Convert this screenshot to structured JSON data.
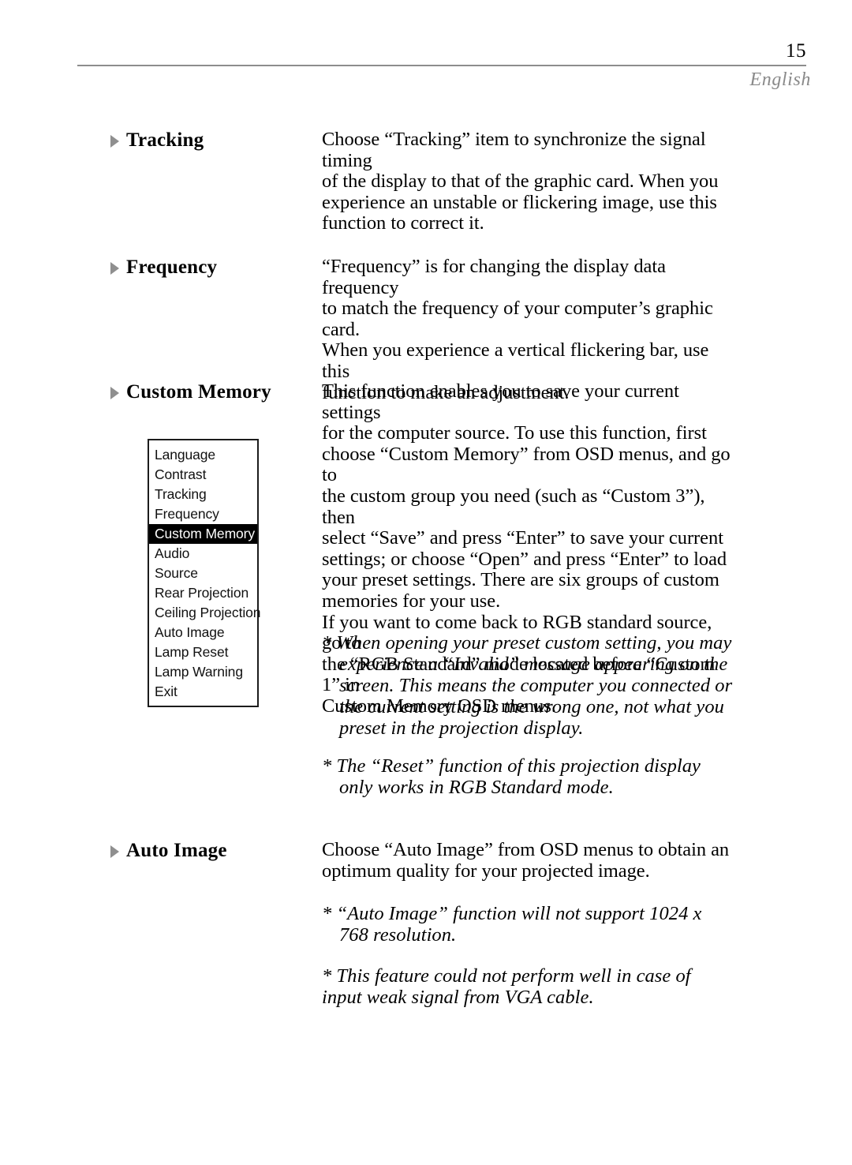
{
  "header": {
    "page_number": "15",
    "language_label": "English"
  },
  "sections": [
    {
      "id": "tracking",
      "heading": "Tracking",
      "bullet_icon": "triangle-right-icon",
      "body": "Choose “Tracking” item to synchronize the signal timing\nof the display to that of the graphic card.  When you\nexperience an unstable or flickering image, use this\nfunction to correct it."
    },
    {
      "id": "frequency",
      "heading": "Frequency",
      "bullet_icon": "triangle-right-icon",
      "body": "“Frequency” is for changing the display data frequency\nto match the frequency of your computer’s graphic card.\nWhen you experience a vertical flickering bar, use this\nfunction to make an adjustment."
    },
    {
      "id": "custom-memory",
      "heading": "Custom Memory",
      "bullet_icon": "triangle-right-icon",
      "body": "This function enables you to save your current settings\nfor the computer source.  To use this function, first\nchoose “Custom Memory” from OSD menus, and go to\nthe custom group you need (such as “Custom 3”), then\nselect “Save” and press “Enter” to save your current\nsettings; or choose “Open” and press “Enter” to load\nyour preset settings. There are six groups of custom\nmemories for your use.\nIf you want to come back to RGB standard source, go to\nthe “RGB Standard” mode located before “Custom 1” in\nCustom Memory OSD menus."
    },
    {
      "id": "auto-image",
      "heading": "Auto Image",
      "bullet_icon": "triangle-right-icon",
      "body": "Choose “Auto Image” from OSD menus to obtain an\noptimum quality for your projected image."
    }
  ],
  "notes": {
    "custom_memory_1": "* When opening your preset custom setting, you may\nexperience a “Invalid” message appearing on the\nscreen. This means the computer you connected or\nthe current setting is the wrong one, not what you\npreset in the projection display.",
    "custom_memory_2": "* The “Reset” function of this projection display\nonly works in RGB Standard mode.",
    "auto_image_1": "* “Auto Image” function will not support 1024 x\n768 resolution.",
    "auto_image_2": "* This feature could not perform well in case of\ninput weak signal from VGA cable."
  },
  "osd_menu": {
    "selected_item": "Custom Memory",
    "items": [
      {
        "label": "Language",
        "selected": false
      },
      {
        "label": "Contrast",
        "selected": false
      },
      {
        "label": "Tracking",
        "selected": false
      },
      {
        "label": "Frequency",
        "selected": false
      },
      {
        "label": "Custom Memory",
        "selected": true
      },
      {
        "label": "Audio",
        "selected": false
      },
      {
        "label": "Source",
        "selected": false
      },
      {
        "label": "Rear Projection",
        "selected": false
      },
      {
        "label": "Ceiling Projection",
        "selected": false
      },
      {
        "label": "Auto Image",
        "selected": false
      },
      {
        "label": "Lamp Reset",
        "selected": false
      },
      {
        "label": "Lamp Warning",
        "selected": false
      },
      {
        "label": "Exit",
        "selected": false
      }
    ]
  },
  "colors": {
    "rule": "#8d8d8d",
    "language_text": "#8a8a8a",
    "bullet": "#8f8f8f",
    "selection_bg": "#000000",
    "selection_fg": "#ffffff"
  }
}
